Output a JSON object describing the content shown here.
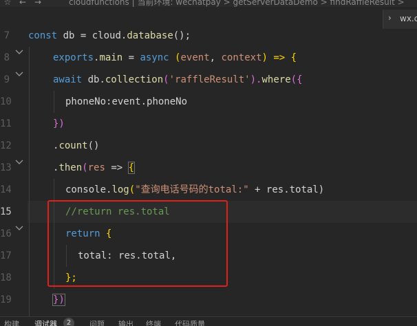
{
  "breadcrumb": {
    "icons": [
      "star-icon",
      "back-arrow-icon",
      "forward-arrow-icon"
    ],
    "path": "cloudfunctions | 当前环境: wechatpay > getServerDataDemo > findRaffleResult > "
  },
  "side_panel": {
    "chevron": "›",
    "label": "wx.c"
  },
  "editor": {
    "line_numbers": [
      "7",
      "8",
      "9",
      "10",
      "11",
      "12",
      "13",
      "14",
      "15",
      "16",
      "17",
      "18",
      "19"
    ],
    "active_line": "15",
    "code": {
      "l7": {
        "a": "const",
        "b": " db = cloud.",
        "c": "database",
        "d": "();"
      },
      "l8": {
        "a": "exports",
        "b": ".",
        "c": "main",
        "d": " = ",
        "e": "async",
        "f": " (",
        "g": "event",
        "h": ", ",
        "i": "context",
        "j": ") => {"
      },
      "l9": {
        "a": "await",
        "b": " db.",
        "c": "collection",
        "d": "(",
        "e": "'raffleResult'",
        "f": ").",
        "g": "where",
        "h": "({"
      },
      "l10": {
        "a": "phoneNo",
        "b": ":event.phoneNo"
      },
      "l11": {
        "a": "})"
      },
      "l12": {
        "a": ".",
        "b": "count",
        "c": "()"
      },
      "l13": {
        "a": ".",
        "b": "then",
        "c": "(",
        "d": "res",
        "e": " => ",
        "f": "{"
      },
      "l14": {
        "a": "console",
        "b": ".",
        "c": "log",
        "d": "(",
        "e": "\"查询电话号码的total:\"",
        "f": " + res.total)"
      },
      "l15": {
        "a": "//return res.total"
      },
      "l16": {
        "a": "return",
        "b": " {"
      },
      "l17": {
        "a": "total",
        "b": ": res.total,"
      },
      "l18": {
        "a": "};"
      },
      "l19": {
        "a": "})"
      }
    }
  },
  "bottom_panel": {
    "tabs": [
      "构建",
      "调试器",
      "问题",
      "输出",
      "终端",
      "代码质量"
    ],
    "active_tab": "调试器",
    "debugger_badge": "2"
  },
  "colors": {
    "background": "#262626",
    "keyword": "#569cd6",
    "function": "#dcdcaa",
    "string": "#ce9178",
    "comment": "#6a9955",
    "highlight_box": "#e0201b"
  }
}
